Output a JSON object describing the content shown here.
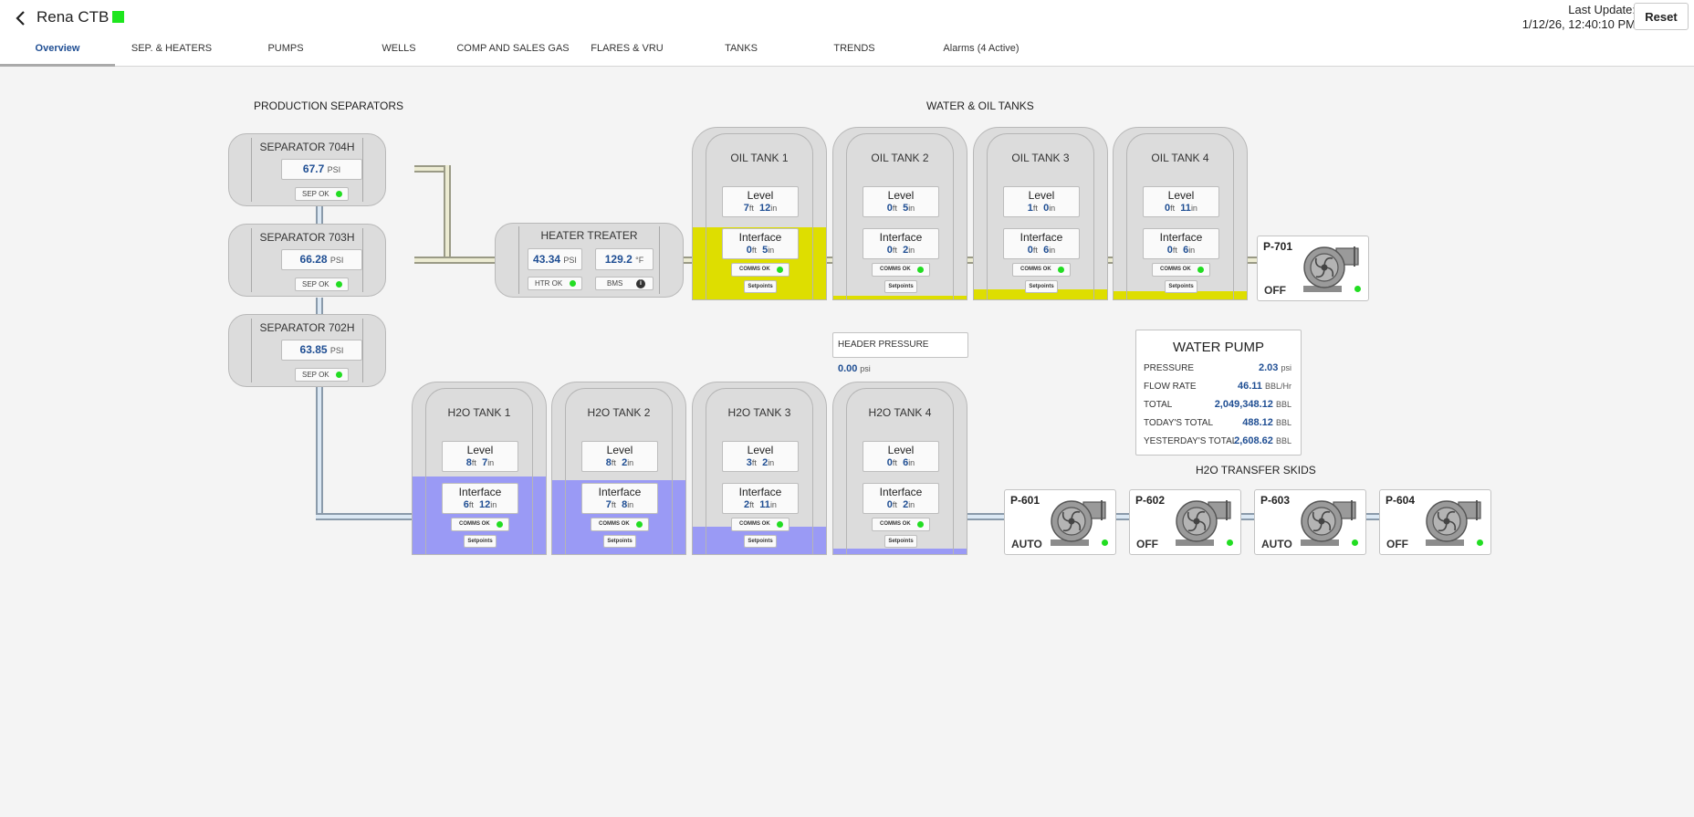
{
  "header": {
    "title": "Rena CTB",
    "last_update_label": "Last Update:",
    "last_update_value": "1/12/26, 12:40:10 PM",
    "reset_label": "Reset",
    "status_color": "#1de61d"
  },
  "tabs": [
    {
      "label": "Overview",
      "active": true
    },
    {
      "label": "SEP. & HEATERS"
    },
    {
      "label": "PUMPS"
    },
    {
      "label": "WELLS"
    },
    {
      "label": "COMP AND SALES GAS"
    },
    {
      "label": "FLARES & VRU"
    },
    {
      "label": "TANKS"
    },
    {
      "label": "TRENDS"
    },
    {
      "label": "Alarms (4 Active)"
    }
  ],
  "sections": {
    "production_separators": "PRODUCTION SEPARATORS",
    "water_oil_tanks": "WATER & OIL TANKS",
    "h2o_transfer_skids": "H2O TRANSFER SKIDS"
  },
  "separators": [
    {
      "name": "SEPARATOR 704H",
      "value": "67.7",
      "unit": "PSI",
      "status": "SEP OK"
    },
    {
      "name": "SEPARATOR 703H",
      "value": "66.28",
      "unit": "PSI",
      "status": "SEP OK"
    },
    {
      "name": "SEPARATOR 702H",
      "value": "63.85",
      "unit": "PSI",
      "status": "SEP OK"
    }
  ],
  "heater_treater": {
    "name": "HEATER TREATER",
    "pressure": "43.34",
    "pressure_unit": "PSI",
    "temp": "129.2",
    "temp_unit": "°F",
    "status": "HTR OK",
    "bms": "BMS"
  },
  "units": {
    "ft": "ft",
    "in": "in"
  },
  "tank_labels": {
    "level": "Level",
    "interface": "Interface",
    "comms": "COMMS OK",
    "setpoints": "Setpoints"
  },
  "oil_tanks": [
    {
      "name": "OIL TANK 1",
      "level_ft": "7",
      "level_in": "12",
      "int_ft": "0",
      "int_in": "5",
      "fill_pct": 42
    },
    {
      "name": "OIL TANK 2",
      "level_ft": "0",
      "level_in": "5",
      "int_ft": "0",
      "int_in": "2",
      "fill_pct": 2
    },
    {
      "name": "OIL TANK 3",
      "level_ft": "1",
      "level_in": "0",
      "int_ft": "0",
      "int_in": "6",
      "fill_pct": 6
    },
    {
      "name": "OIL TANK 4",
      "level_ft": "0",
      "level_in": "11",
      "int_ft": "0",
      "int_in": "6",
      "fill_pct": 5
    }
  ],
  "h2o_tanks": [
    {
      "name": "H2O TANK 1",
      "level_ft": "8",
      "level_in": "7",
      "int_ft": "6",
      "int_in": "12",
      "fill_pct": 45
    },
    {
      "name": "H2O TANK 2",
      "level_ft": "8",
      "level_in": "2",
      "int_ft": "7",
      "int_in": "8",
      "fill_pct": 43
    },
    {
      "name": "H2O TANK 3",
      "level_ft": "3",
      "level_in": "2",
      "int_ft": "2",
      "int_in": "11",
      "fill_pct": 16
    },
    {
      "name": "H2O TANK 4",
      "level_ft": "0",
      "level_in": "6",
      "int_ft": "0",
      "int_in": "2",
      "fill_pct": 3
    }
  ],
  "header_pressure": {
    "label": "HEADER PRESSURE",
    "value": "0.00",
    "unit": "psi"
  },
  "water_pump": {
    "title": "WATER PUMP",
    "rows": [
      {
        "label": "PRESSURE",
        "value": "2.03",
        "unit": "psi"
      },
      {
        "label": "FLOW RATE",
        "value": "46.11",
        "unit": "BBL/Hr"
      },
      {
        "label": "TOTAL",
        "value": "2,049,348.12",
        "unit": "BBL"
      },
      {
        "label": "TODAY'S TOTAL",
        "value": "488.12",
        "unit": "BBL"
      },
      {
        "label": "YESTERDAY'S TOTAL",
        "value": "2,608.62",
        "unit": "BBL"
      }
    ]
  },
  "pumps": [
    {
      "name": "P-701",
      "mode": "OFF"
    },
    {
      "name": "P-601",
      "mode": "AUTO"
    },
    {
      "name": "P-602",
      "mode": "OFF"
    },
    {
      "name": "P-603",
      "mode": "AUTO"
    },
    {
      "name": "P-604",
      "mode": "OFF"
    }
  ],
  "colors": {
    "oil_fill": "#dede00",
    "h2o_fill": "#9a9af5",
    "value_blue": "#1f4e93",
    "ok_green": "#22dd22"
  }
}
